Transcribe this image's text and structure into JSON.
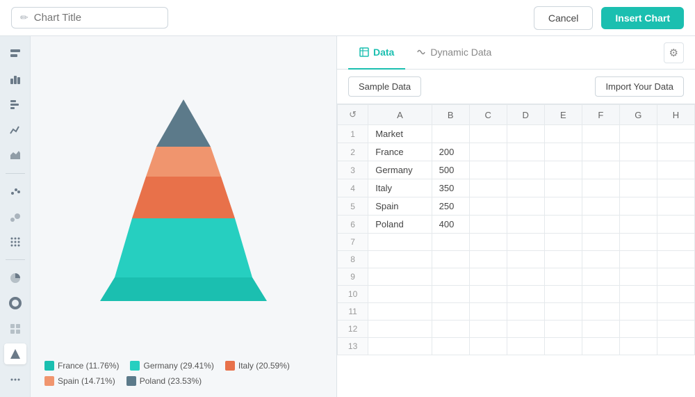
{
  "header": {
    "title_placeholder": "Chart Title",
    "cancel_label": "Cancel",
    "insert_label": "Insert Chart"
  },
  "sidebar": {
    "items": [
      {
        "name": "bar-chart-icon",
        "icon": "▊▊",
        "active": false
      },
      {
        "name": "column-chart-icon",
        "icon": "▲▲",
        "active": false
      },
      {
        "name": "bar-h-icon",
        "icon": "≡",
        "active": false
      },
      {
        "name": "line-chart-icon",
        "icon": "∕",
        "active": false
      },
      {
        "name": "area-chart-icon",
        "icon": "∿",
        "active": false
      },
      {
        "name": "scatter-icon",
        "icon": "⠂⠂",
        "active": false
      },
      {
        "name": "bubble-icon",
        "icon": "⠒⠒",
        "active": false
      },
      {
        "name": "dotted-icon",
        "icon": "⠿⠿",
        "active": false
      },
      {
        "name": "pie-icon",
        "icon": "◔",
        "active": false
      },
      {
        "name": "ring-icon",
        "icon": "○",
        "active": false
      },
      {
        "name": "grid-icon",
        "icon": "⠿",
        "active": false
      },
      {
        "name": "pyramid-icon",
        "icon": "△",
        "active": true
      },
      {
        "name": "more-icon",
        "icon": "⋯",
        "active": false
      }
    ]
  },
  "chart": {
    "segments": [
      {
        "label": "France",
        "value": 200,
        "pct": "11.76%",
        "color": "#1bbfb0"
      },
      {
        "label": "Germany",
        "value": 500,
        "pct": "29.41%",
        "color": "#26cfc0"
      },
      {
        "label": "Italy",
        "value": 350,
        "pct": "20.59%",
        "color": "#e8714a"
      },
      {
        "label": "Spain",
        "value": 250,
        "pct": "14.71%",
        "color": "#f0956e"
      },
      {
        "label": "Poland",
        "value": 400,
        "pct": "23.53%",
        "color": "#5c7a8a"
      }
    ]
  },
  "legend": [
    {
      "label": "France (11.76%)",
      "color": "#1bbfb0"
    },
    {
      "label": "Germany (29.41%)",
      "color": "#26cfc0"
    },
    {
      "label": "Italy (20.59%)",
      "color": "#e8714a"
    },
    {
      "label": "Spain (14.71%)",
      "color": "#f0956e"
    },
    {
      "label": "Poland (23.53%)",
      "color": "#5c7a8a"
    }
  ],
  "tabs": [
    {
      "label": "Data",
      "active": true,
      "icon": "table"
    },
    {
      "label": "Dynamic Data",
      "active": false,
      "icon": "dynamic"
    }
  ],
  "toolbar": {
    "sample_data_label": "Sample Data",
    "import_label": "Import Your Data"
  },
  "table": {
    "columns": [
      "↺",
      "A",
      "B",
      "C",
      "D",
      "E",
      "F",
      "G",
      "H"
    ],
    "rows": [
      {
        "num": "",
        "a": "Market",
        "b": ""
      },
      {
        "num": "2",
        "a": "France",
        "b": "200"
      },
      {
        "num": "3",
        "a": "Germany",
        "b": "500"
      },
      {
        "num": "4",
        "a": "Italy",
        "b": "350"
      },
      {
        "num": "5",
        "a": "Spain",
        "b": "250"
      },
      {
        "num": "6",
        "a": "Poland",
        "b": "400"
      },
      {
        "num": "7",
        "a": "",
        "b": ""
      },
      {
        "num": "8",
        "a": "",
        "b": ""
      },
      {
        "num": "9",
        "a": "",
        "b": ""
      },
      {
        "num": "10",
        "a": "",
        "b": ""
      },
      {
        "num": "11",
        "a": "",
        "b": ""
      },
      {
        "num": "12",
        "a": "",
        "b": ""
      },
      {
        "num": "13",
        "a": "",
        "b": ""
      }
    ]
  }
}
